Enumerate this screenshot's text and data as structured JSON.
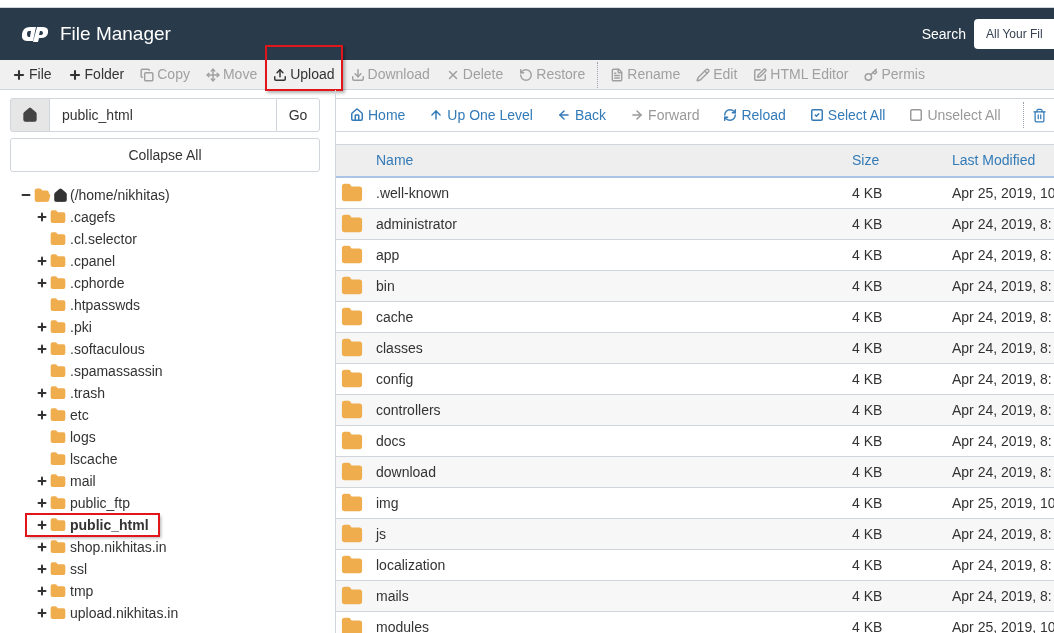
{
  "header": {
    "title": "File Manager",
    "search_label": "Search",
    "search_value": "All Your Fil"
  },
  "toolbar": [
    {
      "label": "File",
      "disabled": false,
      "highlighted": false
    },
    {
      "label": "Folder",
      "disabled": false,
      "highlighted": false
    },
    {
      "label": "Copy",
      "disabled": true,
      "highlighted": false
    },
    {
      "label": "Move",
      "disabled": true,
      "highlighted": false
    },
    {
      "label": "Upload",
      "disabled": false,
      "highlighted": true
    },
    {
      "label": "Download",
      "disabled": true,
      "highlighted": false
    },
    {
      "label": "Delete",
      "disabled": true,
      "highlighted": false
    },
    {
      "label": "Restore",
      "disabled": true,
      "highlighted": false
    },
    {
      "label": "Rename",
      "disabled": true,
      "highlighted": false
    },
    {
      "label": "Edit",
      "disabled": true,
      "highlighted": false
    },
    {
      "label": "HTML Editor",
      "disabled": true,
      "highlighted": false
    },
    {
      "label": "Permis",
      "disabled": true,
      "highlighted": false
    }
  ],
  "path_bar": {
    "value": "public_html",
    "go": "Go"
  },
  "collapse_all": "Collapse All",
  "tree": {
    "label": "(/home/nikhitas)",
    "expanded": true,
    "children": [
      {
        "label": ".cagefs",
        "expandable": true,
        "selected": false,
        "highlighted": false
      },
      {
        "label": ".cl.selector",
        "expandable": false,
        "selected": false,
        "highlighted": false
      },
      {
        "label": ".cpanel",
        "expandable": true,
        "selected": false,
        "highlighted": false
      },
      {
        "label": ".cphorde",
        "expandable": true,
        "selected": false,
        "highlighted": false
      },
      {
        "label": ".htpasswds",
        "expandable": false,
        "selected": false,
        "highlighted": false
      },
      {
        "label": ".pki",
        "expandable": true,
        "selected": false,
        "highlighted": false
      },
      {
        "label": ".softaculous",
        "expandable": true,
        "selected": false,
        "highlighted": false
      },
      {
        "label": ".spamassassin",
        "expandable": false,
        "selected": false,
        "highlighted": false
      },
      {
        "label": ".trash",
        "expandable": true,
        "selected": false,
        "highlighted": false
      },
      {
        "label": "etc",
        "expandable": true,
        "selected": false,
        "highlighted": false
      },
      {
        "label": "logs",
        "expandable": false,
        "selected": false,
        "highlighted": false
      },
      {
        "label": "lscache",
        "expandable": false,
        "selected": false,
        "highlighted": false
      },
      {
        "label": "mail",
        "expandable": true,
        "selected": false,
        "highlighted": false
      },
      {
        "label": "public_ftp",
        "expandable": true,
        "selected": false,
        "highlighted": false
      },
      {
        "label": "public_html",
        "expandable": true,
        "selected": true,
        "highlighted": true
      },
      {
        "label": "shop.nikhitas.in",
        "expandable": true,
        "selected": false,
        "highlighted": false
      },
      {
        "label": "ssl",
        "expandable": true,
        "selected": false,
        "highlighted": false
      },
      {
        "label": "tmp",
        "expandable": true,
        "selected": false,
        "highlighted": false
      },
      {
        "label": "upload.nikhitas.in",
        "expandable": true,
        "selected": false,
        "highlighted": false
      }
    ]
  },
  "nav": [
    {
      "label": "Home",
      "disabled": false
    },
    {
      "label": "Up One Level",
      "disabled": false
    },
    {
      "label": "Back",
      "disabled": false
    },
    {
      "label": "Forward",
      "disabled": true
    },
    {
      "label": "Reload",
      "disabled": false
    },
    {
      "label": "Select All",
      "disabled": false
    },
    {
      "label": "Unselect All",
      "disabled": true
    }
  ],
  "table": {
    "columns": [
      "Name",
      "Size",
      "Last Modified"
    ],
    "rows": [
      {
        "name": ".well-known",
        "size": "4 KB",
        "modified": "Apr 25, 2019, 10"
      },
      {
        "name": "administrator",
        "size": "4 KB",
        "modified": "Apr 24, 2019, 8:"
      },
      {
        "name": "app",
        "size": "4 KB",
        "modified": "Apr 24, 2019, 8:"
      },
      {
        "name": "bin",
        "size": "4 KB",
        "modified": "Apr 24, 2019, 8:"
      },
      {
        "name": "cache",
        "size": "4 KB",
        "modified": "Apr 24, 2019, 8:"
      },
      {
        "name": "classes",
        "size": "4 KB",
        "modified": "Apr 24, 2019, 8:"
      },
      {
        "name": "config",
        "size": "4 KB",
        "modified": "Apr 24, 2019, 8:"
      },
      {
        "name": "controllers",
        "size": "4 KB",
        "modified": "Apr 24, 2019, 8:"
      },
      {
        "name": "docs",
        "size": "4 KB",
        "modified": "Apr 24, 2019, 8:"
      },
      {
        "name": "download",
        "size": "4 KB",
        "modified": "Apr 24, 2019, 8:"
      },
      {
        "name": "img",
        "size": "4 KB",
        "modified": "Apr 25, 2019, 10"
      },
      {
        "name": "js",
        "size": "4 KB",
        "modified": "Apr 24, 2019, 8:"
      },
      {
        "name": "localization",
        "size": "4 KB",
        "modified": "Apr 24, 2019, 8:"
      },
      {
        "name": "mails",
        "size": "4 KB",
        "modified": "Apr 24, 2019, 8:"
      },
      {
        "name": "modules",
        "size": "4 KB",
        "modified": "Apr 25, 2019, 10"
      }
    ]
  }
}
